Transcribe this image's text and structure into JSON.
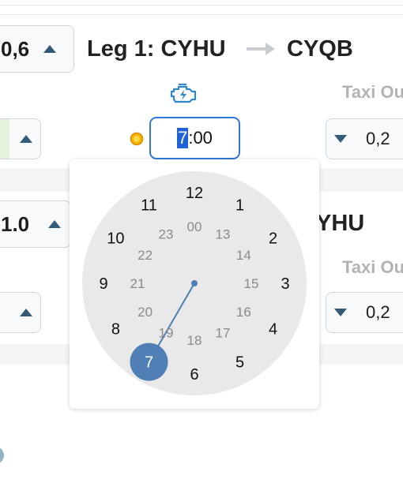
{
  "leg1": {
    "left_value": "0,6",
    "title": "Leg 1: CYHU",
    "destination": "CYQB",
    "taxi_out_label": "Taxi Ou",
    "time_hour": "7",
    "time_rest": ":00",
    "taxi_value": "0,2"
  },
  "leg2": {
    "left_value": "1.0",
    "title_fragment": "YHU",
    "taxi_out_label": "Taxi Ou",
    "taxi_value": "0,2"
  },
  "clock": {
    "outer_hours": [
      "12",
      "1",
      "2",
      "3",
      "4",
      "5",
      "6",
      "7",
      "8",
      "9",
      "10",
      "11"
    ],
    "inner_hours": [
      "00",
      "13",
      "14",
      "15",
      "16",
      "17",
      "18",
      "19",
      "20",
      "21",
      "22",
      "23"
    ],
    "selected_hour": "7"
  },
  "icons": {
    "engine": "engine-icon",
    "sun": "sun-icon",
    "arrow": "arrow-right-icon"
  },
  "colors": {
    "accent": "#2f78d6",
    "selected": "#4f7fb5",
    "dial": "#e9e9e9"
  }
}
